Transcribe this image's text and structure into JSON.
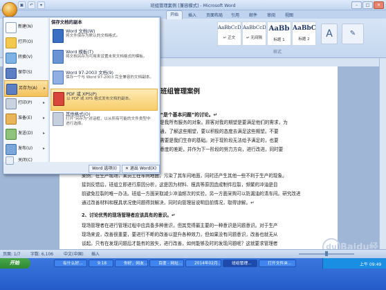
{
  "window": {
    "title": "班组管理案例 [兼容模式] - Microsoft Word",
    "min": "–",
    "max": "□",
    "close": "✕"
  },
  "qat": {
    "save": "▣",
    "undo": "↶",
    "more": "▾"
  },
  "ribbon": {
    "tabs": [
      "开始",
      "插入",
      "页面布局",
      "引用",
      "邮件",
      "审阅",
      "视图"
    ],
    "styles": [
      {
        "sample": "AaBbCcDc",
        "name": "↵ 正文"
      },
      {
        "sample": "AaBbCcDc",
        "name": "↵ 无间隔"
      },
      {
        "sample": "AaBb",
        "name": "标题 1"
      },
      {
        "sample": "AaBbC",
        "name": "标题 2"
      }
    ],
    "group_label": "样式"
  },
  "office_menu": {
    "items": [
      {
        "label": "新建(N)"
      },
      {
        "label": "打开(O)"
      },
      {
        "label": "转换(V)"
      },
      {
        "label": "保存(S)"
      },
      {
        "label": "另存为(A)"
      },
      {
        "label": "打印(P)"
      },
      {
        "label": "准备(E)"
      },
      {
        "label": "发送(D)"
      },
      {
        "label": "发布(U)"
      },
      {
        "label": "关闭(C)"
      }
    ],
    "submenu_title": "保存文档的副本",
    "submenu": [
      {
        "title": "Word 文档(W)",
        "desc": "将文件保存为默认的文档格式。"
      },
      {
        "title": "Word 模板(T)",
        "desc": "将文档另存为可用来设置未来文档格式的模板。"
      },
      {
        "title": "Word 97-2003 文档(9)",
        "desc": "保存一个与 Word 97-2003 完全兼容的文档副本。"
      },
      {
        "title": "PDF 或 XPS(P)",
        "desc": "以 PDF 或 XPS 格式发布文档的副本。"
      },
      {
        "title": "其他格式(O)",
        "desc": "打开\"另存为\"对话框，以从所有可能的文件类型中进行选择。"
      }
    ],
    "options_btn": "Word 选项(I)",
    "exit_btn": "✕ 退出 Word(X)"
  },
  "document": {
    "title": "班组管理案例",
    "heading1": "一、“是个基本问题”的讨论。↵",
    "right_lines": [
      "顾客是我所有服务的对象。顾客对我的期望是要满足他们的需求，为",
      "的沟通，了解这些期望，要以积极的态度去满足这些期望。不要",
      "客的需要是我们生存的基础。对于现阶段无法给予满足的，也要",
      "客满意度的差距，并作为下一阶段的努力方向，进行改进，同时要"
    ],
    "full_lines": [
      "案例：在生产现场，某员工在车间地面，污染了其车间地面，同时还产生其他一些不利于生产的现象。",
      "接到反馈后，班组立即进行原因分析，这是因为材料、模具等原因造成制件拉裂，频繁的冲油是目",
      "前避免拉裂的唯一办法。班组一方面采取减少冲油频次的实验，另一方面采购可以防漏油的清车间。研究改进",
      "通过改善材料和模具状况使问题得到解决，同时向管理层说明目前情况，取得谅解。↵",
      "2、讨论优秀的现场管理者应该具有的意识。↵",
      "现场管理者在进行管理过程中应具备多种意识，但其觉得最主要的一种意识是问题意识。对于生产",
      "现场来说，改善很重要，要进行不断的改善以提升各种效力，但如果没有问题意识，改善也就无从",
      "谈起。只有在发现问题后才能有的放矢，进行改善，如何能够及时的发现问题呢？这就要求管理者",
      "同时具有作业标准化的意识，标准化实际就是制定标准、执行标准、完善标准的一个循环过程，有",
      "了标准，在执行过程中才容易暴露问题，发现问题所在，进行改善，完善标准。↵"
    ]
  },
  "status": {
    "page": "页面: 1/7",
    "words": "字数: 6,106",
    "lang": "中文(中国)",
    "mode": "插入"
  },
  "watermark": {
    "text": "Baidu经验",
    "paw": "du",
    "sub": "jingyan.baidu.com"
  },
  "taskbar": {
    "start": "开始",
    "tasks": [
      "有什么好...",
      "9:18",
      "你好，网友...",
      "百度 - 网址...",
      "2014年02月...",
      "班组管理...",
      "打开文件夹..."
    ],
    "clock": "上午 09:49"
  }
}
